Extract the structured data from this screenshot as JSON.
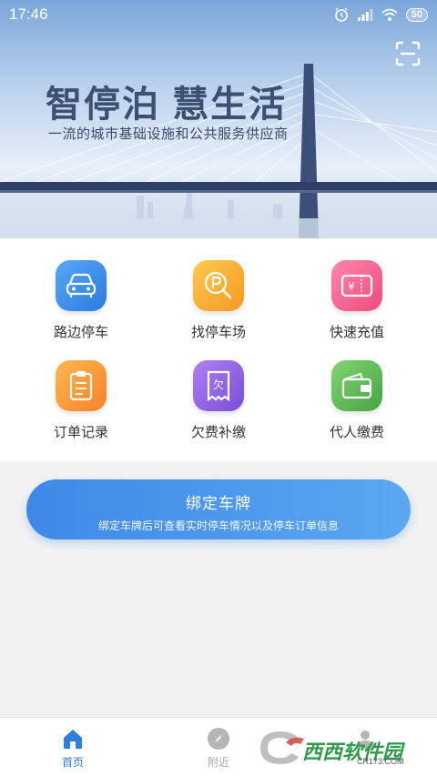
{
  "status_bar": {
    "time": "17:46",
    "battery": "50"
  },
  "hero": {
    "title": "智停泊 慧生活",
    "subtitle": "一流的城市基础设施和公共服务供应商"
  },
  "services": [
    {
      "label": "路边停车",
      "icon": "car-icon",
      "color_from": "#4fa2f5",
      "color_to": "#2c7de0"
    },
    {
      "label": "找停车场",
      "icon": "parking-search-icon",
      "color_from": "#ffc24a",
      "color_to": "#f59b23"
    },
    {
      "label": "快速充值",
      "icon": "recharge-card-icon",
      "color_from": "#ff7ea6",
      "color_to": "#f04e7c"
    },
    {
      "label": "订单记录",
      "icon": "clipboard-icon",
      "color_from": "#ffb34d",
      "color_to": "#f5832a"
    },
    {
      "label": "欠费补缴",
      "icon": "bill-icon",
      "color_from": "#a97bf0",
      "color_to": "#7b4fd8"
    },
    {
      "label": "代人缴费",
      "icon": "wallet-icon",
      "color_from": "#7dd06c",
      "color_to": "#47a845"
    }
  ],
  "bind_plate": {
    "title": "绑定车牌",
    "description": "绑定车牌后可查看实时停车情况以及停车订单信息"
  },
  "tabs": [
    {
      "label": "首页",
      "active": true
    },
    {
      "label": "附近",
      "active": false
    }
  ],
  "watermark": {
    "text": "西西软件园",
    "sub": "CR173.COM"
  },
  "colors": {
    "accent": "#2d7fe0",
    "inactive": "#aaaaaa"
  }
}
